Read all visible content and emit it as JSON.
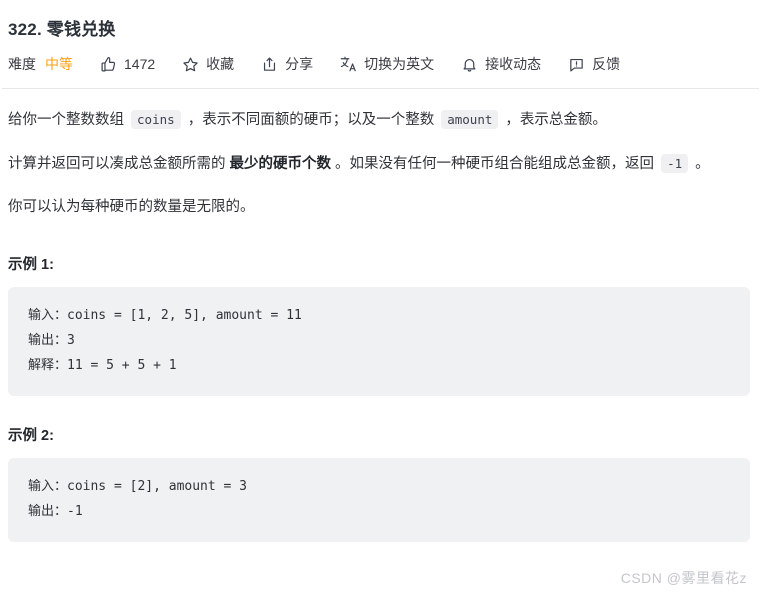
{
  "problem": {
    "title": "322. 零钱兑换"
  },
  "toolbar": {
    "difficulty_label": "难度",
    "difficulty_value": "中等",
    "difficulty_color": "#ffa116",
    "items": [
      {
        "icon": "thumbs-up-icon",
        "label": "1472"
      },
      {
        "icon": "star-icon",
        "label": "收藏"
      },
      {
        "icon": "share-icon",
        "label": "分享"
      },
      {
        "icon": "translate-icon",
        "label": "切换为英文"
      },
      {
        "icon": "bell-icon",
        "label": "接收动态"
      },
      {
        "icon": "feedback-icon",
        "label": "反馈"
      }
    ]
  },
  "description": {
    "p1_a": "给你一个整数数组 ",
    "p1_code1": "coins",
    "p1_b": " ，表示不同面额的硬币；以及一个整数 ",
    "p1_code2": "amount",
    "p1_c": " ，表示总金额。",
    "p2_a": "计算并返回可以凑成总金额所需的 ",
    "p2_bold": "最少的硬币个数",
    "p2_b": " 。如果没有任何一种硬币组合能组成总金额，返回 ",
    "p2_code": "-1",
    "p2_c": " 。",
    "p3": "你可以认为每种硬币的数量是无限的。"
  },
  "examples": [
    {
      "heading": "示例 1:",
      "lines": [
        "输入：coins = [1, 2, 5], amount = 11",
        "输出：3",
        "解释：11 = 5 + 5 + 1"
      ]
    },
    {
      "heading": "示例 2:",
      "lines": [
        "输入：coins = [2], amount = 3",
        "输出：-1"
      ]
    }
  ],
  "watermark": "CSDN @雾里看花z"
}
